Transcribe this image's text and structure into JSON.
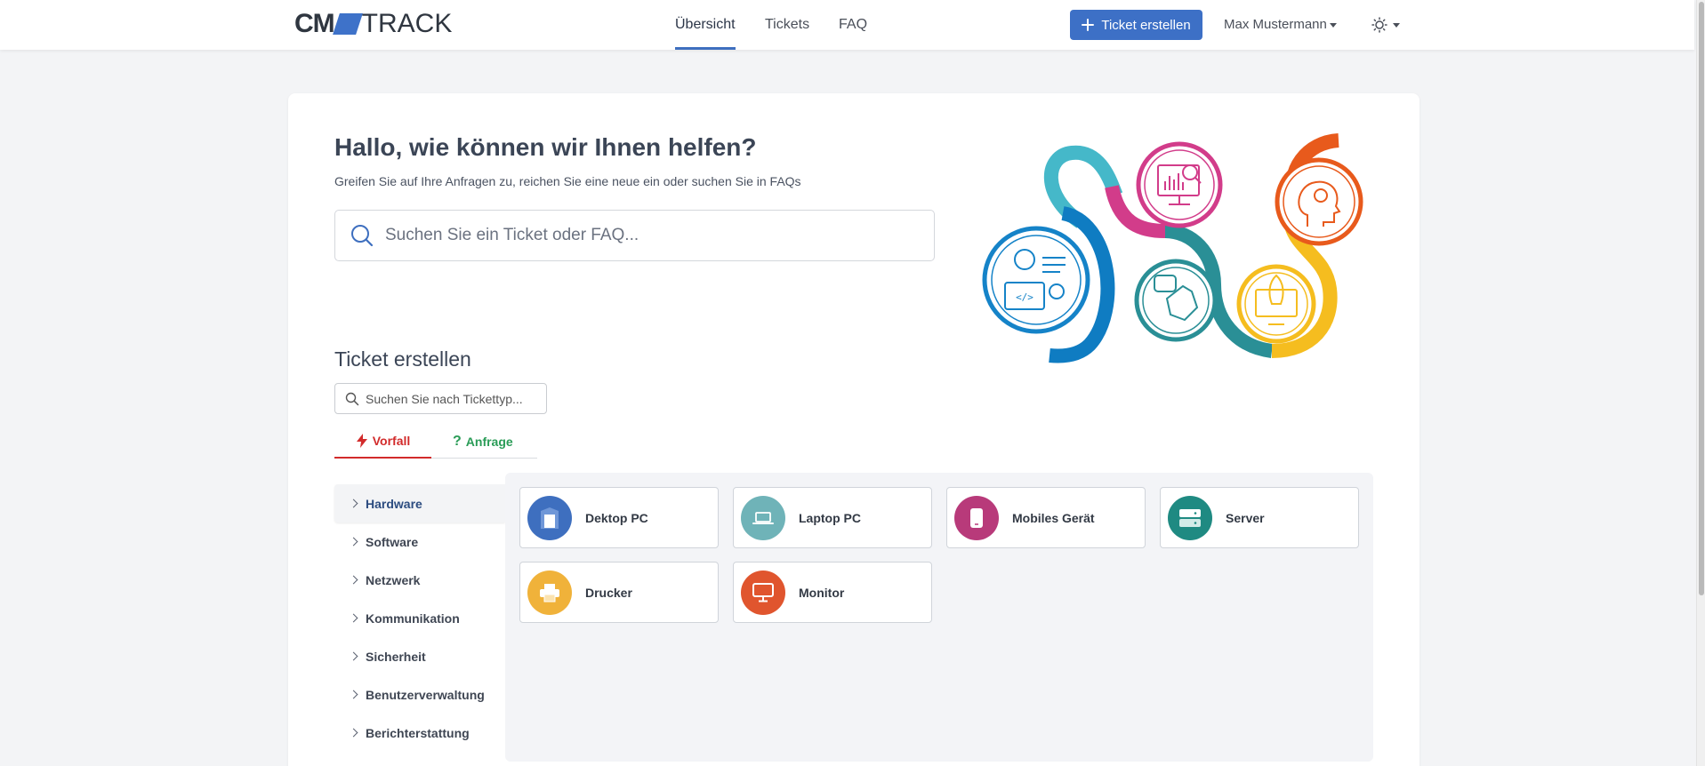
{
  "app": {
    "logo_left": "CM",
    "logo_right": "TRACK"
  },
  "nav": {
    "items": [
      {
        "label": "Übersicht",
        "active": true
      },
      {
        "label": "Tickets",
        "active": false
      },
      {
        "label": "FAQ",
        "active": false
      }
    ],
    "create_button": "Ticket erstellen",
    "user": "Max Mustermann"
  },
  "hero": {
    "title": "Hallo, wie können wir Ihnen helfen?",
    "subtitle": "Greifen Sie auf Ihre Anfragen zu, reichen Sie eine neue ein oder suchen Sie in FAQs",
    "search_placeholder": "Suchen Sie ein Ticket oder FAQ..."
  },
  "create_ticket": {
    "title": "Ticket erstellen",
    "search_placeholder": "Suchen Sie nach Tickettyp...",
    "tabs": [
      {
        "label": "Vorfall",
        "icon": "bolt-icon",
        "color": "#d22b2b",
        "active": true
      },
      {
        "label": "Anfrage",
        "icon": "question-icon",
        "color": "#2a9c57",
        "active": false
      }
    ],
    "categories": [
      {
        "label": "Hardware",
        "active": true
      },
      {
        "label": "Software",
        "active": false
      },
      {
        "label": "Netzwerk",
        "active": false
      },
      {
        "label": "Kommunikation",
        "active": false
      },
      {
        "label": "Sicherheit",
        "active": false
      },
      {
        "label": "Benutzerverwaltung",
        "active": false
      },
      {
        "label": "Berichterstattung",
        "active": false
      }
    ],
    "tiles": [
      {
        "label": "Dektop PC",
        "icon": "desktop-tower-icon",
        "color": "#3e6fbf"
      },
      {
        "label": "Laptop PC",
        "icon": "laptop-icon",
        "color": "#6fb3b8"
      },
      {
        "label": "Mobiles Gerät",
        "icon": "mobile-icon",
        "color": "#b83a7a"
      },
      {
        "label": "Server",
        "icon": "server-icon",
        "color": "#1f8a82"
      },
      {
        "label": "Drucker",
        "icon": "printer-icon",
        "color": "#f0b23a"
      },
      {
        "label": "Monitor",
        "icon": "monitor-icon",
        "color": "#e0552e"
      }
    ]
  },
  "colors": {
    "primary": "#3d70c6",
    "active_tab_underline": "#3e6fbf",
    "vorfall": "#d22b2b",
    "anfrage": "#2a9c57"
  }
}
